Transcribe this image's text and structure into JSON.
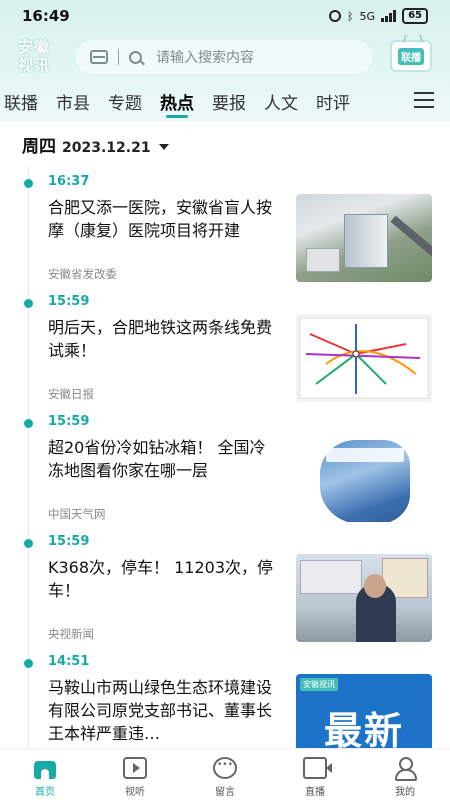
{
  "status_bar": {
    "time": "16:49",
    "network": "5G",
    "battery": "65"
  },
  "header": {
    "logo": "安徽视讯",
    "search_placeholder": "请输入搜索内容",
    "lianbo_label": "联播"
  },
  "tabs": [
    {
      "label": "联播"
    },
    {
      "label": "市县"
    },
    {
      "label": "专题"
    },
    {
      "label": "热点",
      "active": true
    },
    {
      "label": "要报"
    },
    {
      "label": "人文"
    },
    {
      "label": "时评"
    }
  ],
  "date_row": {
    "weekday": "周四",
    "date": "2023.12.21"
  },
  "feed": [
    {
      "time": "16:37",
      "title": "合肥又添一医院，安徽省盲人按摩（康复）医院项目将开建",
      "source": "安徽省发改委"
    },
    {
      "time": "15:59",
      "title": "明后天，合肥地铁这两条线免费试乘！",
      "source": "安徽日报"
    },
    {
      "time": "15:59",
      "title": "超20省份冷如钻冰箱！ 全国冷冻地图看你家在哪一层",
      "source": "中国天气网"
    },
    {
      "time": "15:59",
      "title": "K368次，停车！ 11203次，停车！",
      "source": "央视新闻"
    },
    {
      "time": "14:51",
      "title": "马鞍山市两山绿色生态环境建设有限公司原党支部书记、董事长王本祥严重违…",
      "source": "",
      "thumb_badge": "安徽视讯",
      "thumb_text": "最新"
    }
  ],
  "bottom_nav": [
    {
      "label": "首页",
      "icon": "home-icon",
      "active": true
    },
    {
      "label": "视听",
      "icon": "video-icon"
    },
    {
      "label": "留言",
      "icon": "message-icon"
    },
    {
      "label": "直播",
      "icon": "live-icon"
    },
    {
      "label": "我的",
      "icon": "profile-icon"
    }
  ],
  "colors": {
    "accent": "#18a8a8",
    "header_bg": "#d7f1ef"
  }
}
